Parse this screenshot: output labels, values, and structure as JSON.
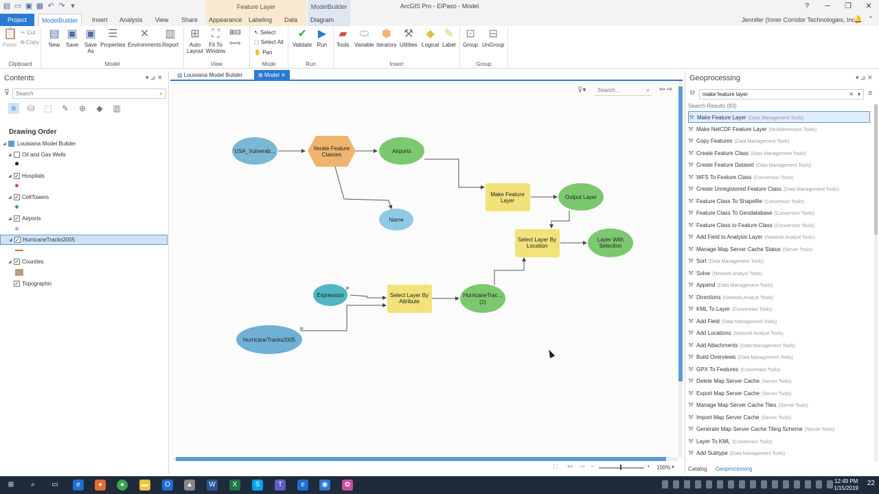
{
  "window": {
    "title": "ArcGIS Pro - ElPaso - Model",
    "context_feature_layer": "Feature Layer",
    "context_modelbuilder": "ModelBuilder",
    "user": "Jennifer (Inner Corridor Technologies, Inc.)"
  },
  "tabs": [
    "Project",
    "ModelBuilder",
    "Insert",
    "Analysis",
    "View",
    "Share",
    "Appearance",
    "Labeling",
    "Data",
    "Diagram"
  ],
  "ribbon": {
    "clipboard": {
      "paste": "Paste",
      "cut": "Cut",
      "copy": "Copy",
      "group": "Clipboard"
    },
    "model": {
      "new": "New",
      "save": "Save",
      "save_as": "Save As",
      "properties": "Properties",
      "environments": "Environments",
      "report": "Report",
      "group": "Model"
    },
    "view": {
      "auto_layout": "Auto Layout",
      "fit_to_window": "Fit To Window",
      "group": "View"
    },
    "mode": {
      "select": "Select",
      "select_all": "Select All",
      "pan": "Pan",
      "group": "Mode"
    },
    "run": {
      "validate": "Validate",
      "run": "Run",
      "group": "Run"
    },
    "insert": {
      "tools": "Tools",
      "variable": "Variable",
      "iterators": "Iterators",
      "utilities": "Utilities",
      "logical": "Logical",
      "label": "Label",
      "group": "Insert"
    },
    "group_grp": {
      "group": "Group",
      "ungroup": "UnGroup",
      "label": "Group"
    }
  },
  "contents": {
    "title": "Contents",
    "search_placeholder": "Search",
    "drawing_order": "Drawing Order",
    "map": "Louisiana Model Builder",
    "layers": [
      {
        "name": "Oil and Gas Wells",
        "checked": false
      },
      {
        "name": "Hospitals",
        "checked": true
      },
      {
        "name": "CellTowers",
        "checked": true
      },
      {
        "name": "Airports",
        "checked": true
      },
      {
        "name": "HurricaneTracks2005",
        "checked": true
      },
      {
        "name": "Counties",
        "checked": true
      },
      {
        "name": "Topographic",
        "checked": true
      }
    ]
  },
  "view_tabs": {
    "la": "Louisiana Model Builder",
    "model": "Model"
  },
  "canvas": {
    "search_placeholder": "Search...",
    "zoom": "100%",
    "nodes": {
      "usa": "USA_Vulnerab...",
      "iterate1": "Iterate Feature",
      "iterate2": "Classes",
      "airports": "Airports",
      "name": "Name",
      "make1": "Make Feature",
      "make2": "Layer",
      "output": "Output Layer",
      "sel_loc1": "Select Layer By",
      "sel_loc2": "Location",
      "lws1": "Layer With",
      "lws2": "Selection",
      "expression": "Expression",
      "sel_attr1": "Select Layer By",
      "sel_attr2": "Attribute",
      "ht1": "HurricaneTrac...",
      "ht2": "(2)",
      "ht_input": "HurricaneTracks2005",
      "p1": "P",
      "p2": "P"
    }
  },
  "geoprocessing": {
    "title": "Geoprocessing",
    "search_value": "make feature layer",
    "results_count": "Search Results (83)",
    "results": [
      {
        "name": "Make Feature Layer",
        "toolbox": "(Data Management Tools)"
      },
      {
        "name": "Make NetCDF Feature Layer",
        "toolbox": "(Multidimension Tools)"
      },
      {
        "name": "Copy Features",
        "toolbox": "(Data Management Tools)"
      },
      {
        "name": "Create Feature Class",
        "toolbox": "(Data Management Tools)"
      },
      {
        "name": "Create Feature Dataset",
        "toolbox": "(Data Management Tools)"
      },
      {
        "name": "WFS To Feature Class",
        "toolbox": "(Conversion Tools)"
      },
      {
        "name": "Create Unregistered Feature Class",
        "toolbox": "(Data Management Tools)"
      },
      {
        "name": "Feature Class To Shapefile",
        "toolbox": "(Conversion Tools)"
      },
      {
        "name": "Feature Class To Geodatabase",
        "toolbox": "(Conversion Tools)"
      },
      {
        "name": "Feature Class to Feature Class",
        "toolbox": "(Conversion Tools)"
      },
      {
        "name": "Add Field to Analysis Layer",
        "toolbox": "(Network Analyst Tools)"
      },
      {
        "name": "Manage Map Server Cache Status",
        "toolbox": "(Server Tools)"
      },
      {
        "name": "Sort",
        "toolbox": "(Data Management Tools)"
      },
      {
        "name": "Solve",
        "toolbox": "(Network Analyst Tools)"
      },
      {
        "name": "Append",
        "toolbox": "(Data Management Tools)"
      },
      {
        "name": "Directions",
        "toolbox": "(Network Analyst Tools)"
      },
      {
        "name": "KML To Layer",
        "toolbox": "(Conversion Tools)"
      },
      {
        "name": "Add Field",
        "toolbox": "(Data Management Tools)"
      },
      {
        "name": "Add Locations",
        "toolbox": "(Network Analyst Tools)"
      },
      {
        "name": "Add Attachments",
        "toolbox": "(Data Management Tools)"
      },
      {
        "name": "Build Overviews",
        "toolbox": "(Data Management Tools)"
      },
      {
        "name": "GPX To Features",
        "toolbox": "(Conversion Tools)"
      },
      {
        "name": "Delete Map Server Cache",
        "toolbox": "(Server Tools)"
      },
      {
        "name": "Export Map Server Cache",
        "toolbox": "(Server Tools)"
      },
      {
        "name": "Manage Map Server Cache Tiles",
        "toolbox": "(Server Tools)"
      },
      {
        "name": "Import Map Server Cache",
        "toolbox": "(Server Tools)"
      },
      {
        "name": "Generate Map Server Cache Tiling Scheme",
        "toolbox": "(Server Tools)"
      },
      {
        "name": "Layer To KML",
        "toolbox": "(Conversion Tools)"
      },
      {
        "name": "Add Subtype",
        "toolbox": "(Data Management Tools)"
      }
    ],
    "bottom_tabs": {
      "catalog": "Catalog",
      "geoprocessing": "Geoprocessing"
    }
  },
  "taskbar": {
    "time": "12:49 PM",
    "date": "1/15/2019",
    "notifications": "22"
  },
  "colors": {
    "accent": "#2b79d1",
    "data_node": "#7ab8d6",
    "tool_node": "#f1e27a",
    "output_node": "#7cc86e",
    "iterator_node": "#f0b46e"
  }
}
